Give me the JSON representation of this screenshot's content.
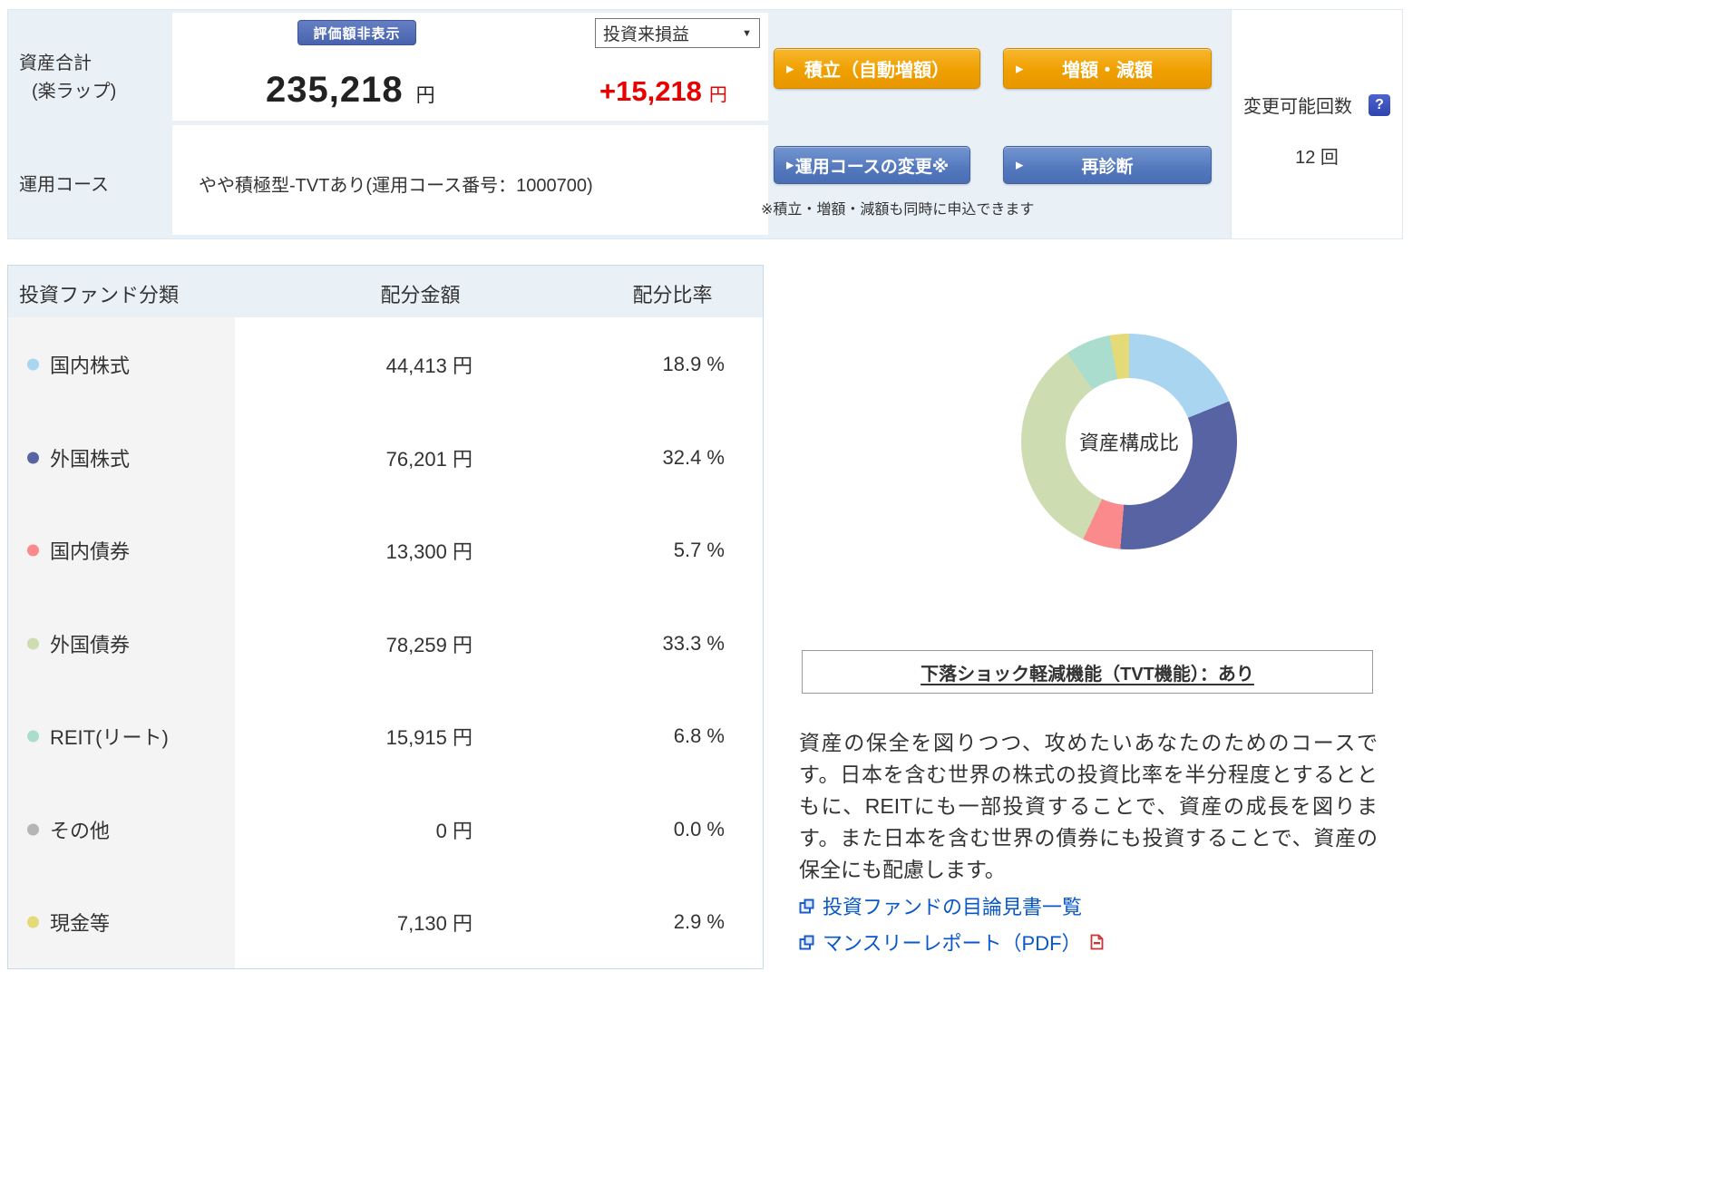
{
  "header": {
    "asset_total_label": "資産合計",
    "asset_total_sublabel": "(楽ラップ)",
    "hide_value_button": "評価額非表示",
    "total_amount": "235,218",
    "yen_unit": "円",
    "pl_select_value": "投資来損益",
    "pl_amount": "+15,218",
    "pl_unit": "円",
    "reserve_button": "積立（自動増額）",
    "adjust_button": "増額・減額",
    "course_label": "運用コース",
    "course_value": "やや積極型-TVTあり(運用コース番号：1000700)",
    "change_course_button": "運用コースの変更※",
    "rediagnose_button": "再診断",
    "note": "※積立・増額・減額も同時に申込できます",
    "change_limit_label": "変更可能回数",
    "change_limit_value": "12 回"
  },
  "icons": {
    "button_arrow": "▶",
    "dropdown_arrow": "▼",
    "help": "?",
    "external_link": "external-link-icon",
    "pdf": "pdf-icon"
  },
  "allocation_table": {
    "headers": [
      "投資ファンド分類",
      "配分金額",
      "配分比率"
    ],
    "rows": [
      {
        "label": "国内株式",
        "amount": "44,413 円",
        "ratio": "18.9 %"
      },
      {
        "label": "外国株式",
        "amount": "76,201 円",
        "ratio": "32.4 %"
      },
      {
        "label": "国内債券",
        "amount": "13,300 円",
        "ratio": "5.7 %"
      },
      {
        "label": "外国債券",
        "amount": "78,259 円",
        "ratio": "33.3 %"
      },
      {
        "label": "REIT(リート)",
        "amount": "15,915 円",
        "ratio": "6.8 %"
      },
      {
        "label": "その他",
        "amount": "0 円",
        "ratio": "0.0 %"
      },
      {
        "label": "現金等",
        "amount": "7,130 円",
        "ratio": "2.9 %"
      }
    ]
  },
  "chart_data": {
    "type": "pie",
    "donut": true,
    "title": "資産構成比",
    "labels": [
      "国内株式",
      "外国株式",
      "国内債券",
      "外国債券",
      "REIT(リート)",
      "その他",
      "現金等"
    ],
    "values": [
      18.9,
      32.4,
      5.7,
      33.3,
      6.8,
      0.0,
      2.9
    ],
    "amounts_yen": [
      44413,
      76201,
      13300,
      78259,
      15915,
      0,
      7130
    ],
    "unit": "%",
    "colors": [
      "#a9d5f0",
      "#5763a3",
      "#fb8a8c",
      "#cedcb2",
      "#aaddcd",
      "#b5b5b5",
      "#e4da78"
    ],
    "start_angle_deg": 0,
    "direction": "clockwise"
  },
  "course_info": {
    "tvt_title": "下落ショック軽減機能（TVT機能）：あり",
    "description": "資産の保全を図りつつ、攻めたいあなたのためのコースです。日本を含む世界の株式の投資比率を半分程度とするとともに、REITにも一部投資することで、資産の成長を図ります。また日本を含む世界の債券にも投資することで、資産の保全にも配慮します。",
    "links": [
      "投資ファンドの目論見書一覧",
      "マンスリーレポート（PDF）"
    ]
  }
}
